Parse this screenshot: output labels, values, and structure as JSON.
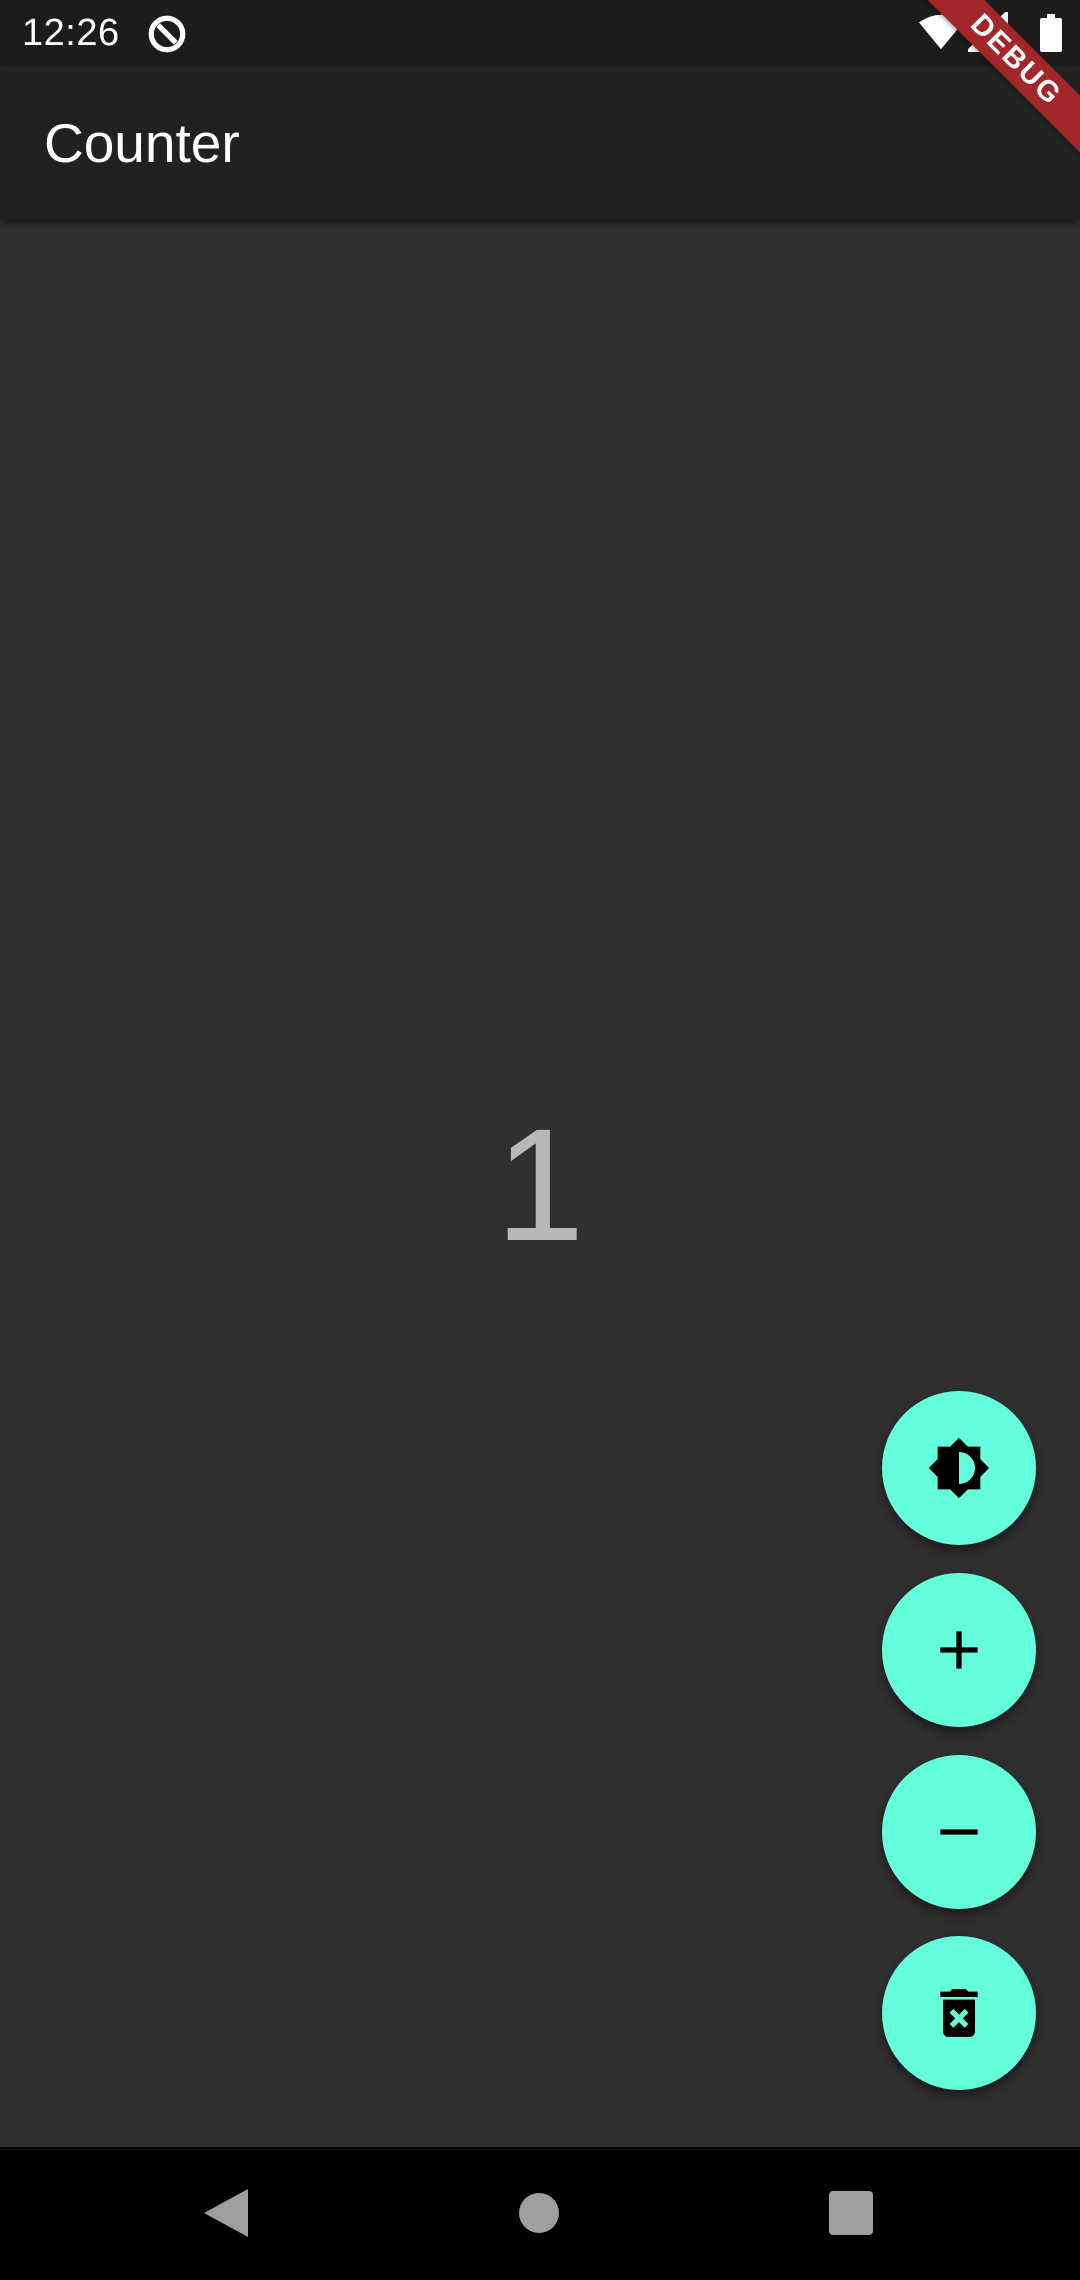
{
  "status_bar": {
    "time": "12:26",
    "icons": [
      "app-notification-icon",
      "wifi-icon",
      "signal-icon",
      "battery-icon"
    ]
  },
  "app_bar": {
    "title": "Counter"
  },
  "debug_banner": "DEBUG",
  "counter": {
    "value": "1"
  },
  "fab_buttons": [
    {
      "name": "theme-toggle-button",
      "icon": "brightness-contrast-icon"
    },
    {
      "name": "increment-button",
      "icon": "plus-icon"
    },
    {
      "name": "decrement-button",
      "icon": "minus-icon"
    },
    {
      "name": "reset-button",
      "icon": "delete-forever-icon"
    }
  ],
  "nav_bar": {
    "buttons": [
      "back-icon",
      "home-icon",
      "recents-icon"
    ]
  },
  "colors": {
    "background": "#303030",
    "app_bar": "#212121",
    "status_bar": "#1c1c1c",
    "fab": "#64ffda",
    "fab_icon": "#000000",
    "counter_text": "#b8b8b8",
    "debug_banner": "#a3262b",
    "nav_bar": "#000000"
  }
}
